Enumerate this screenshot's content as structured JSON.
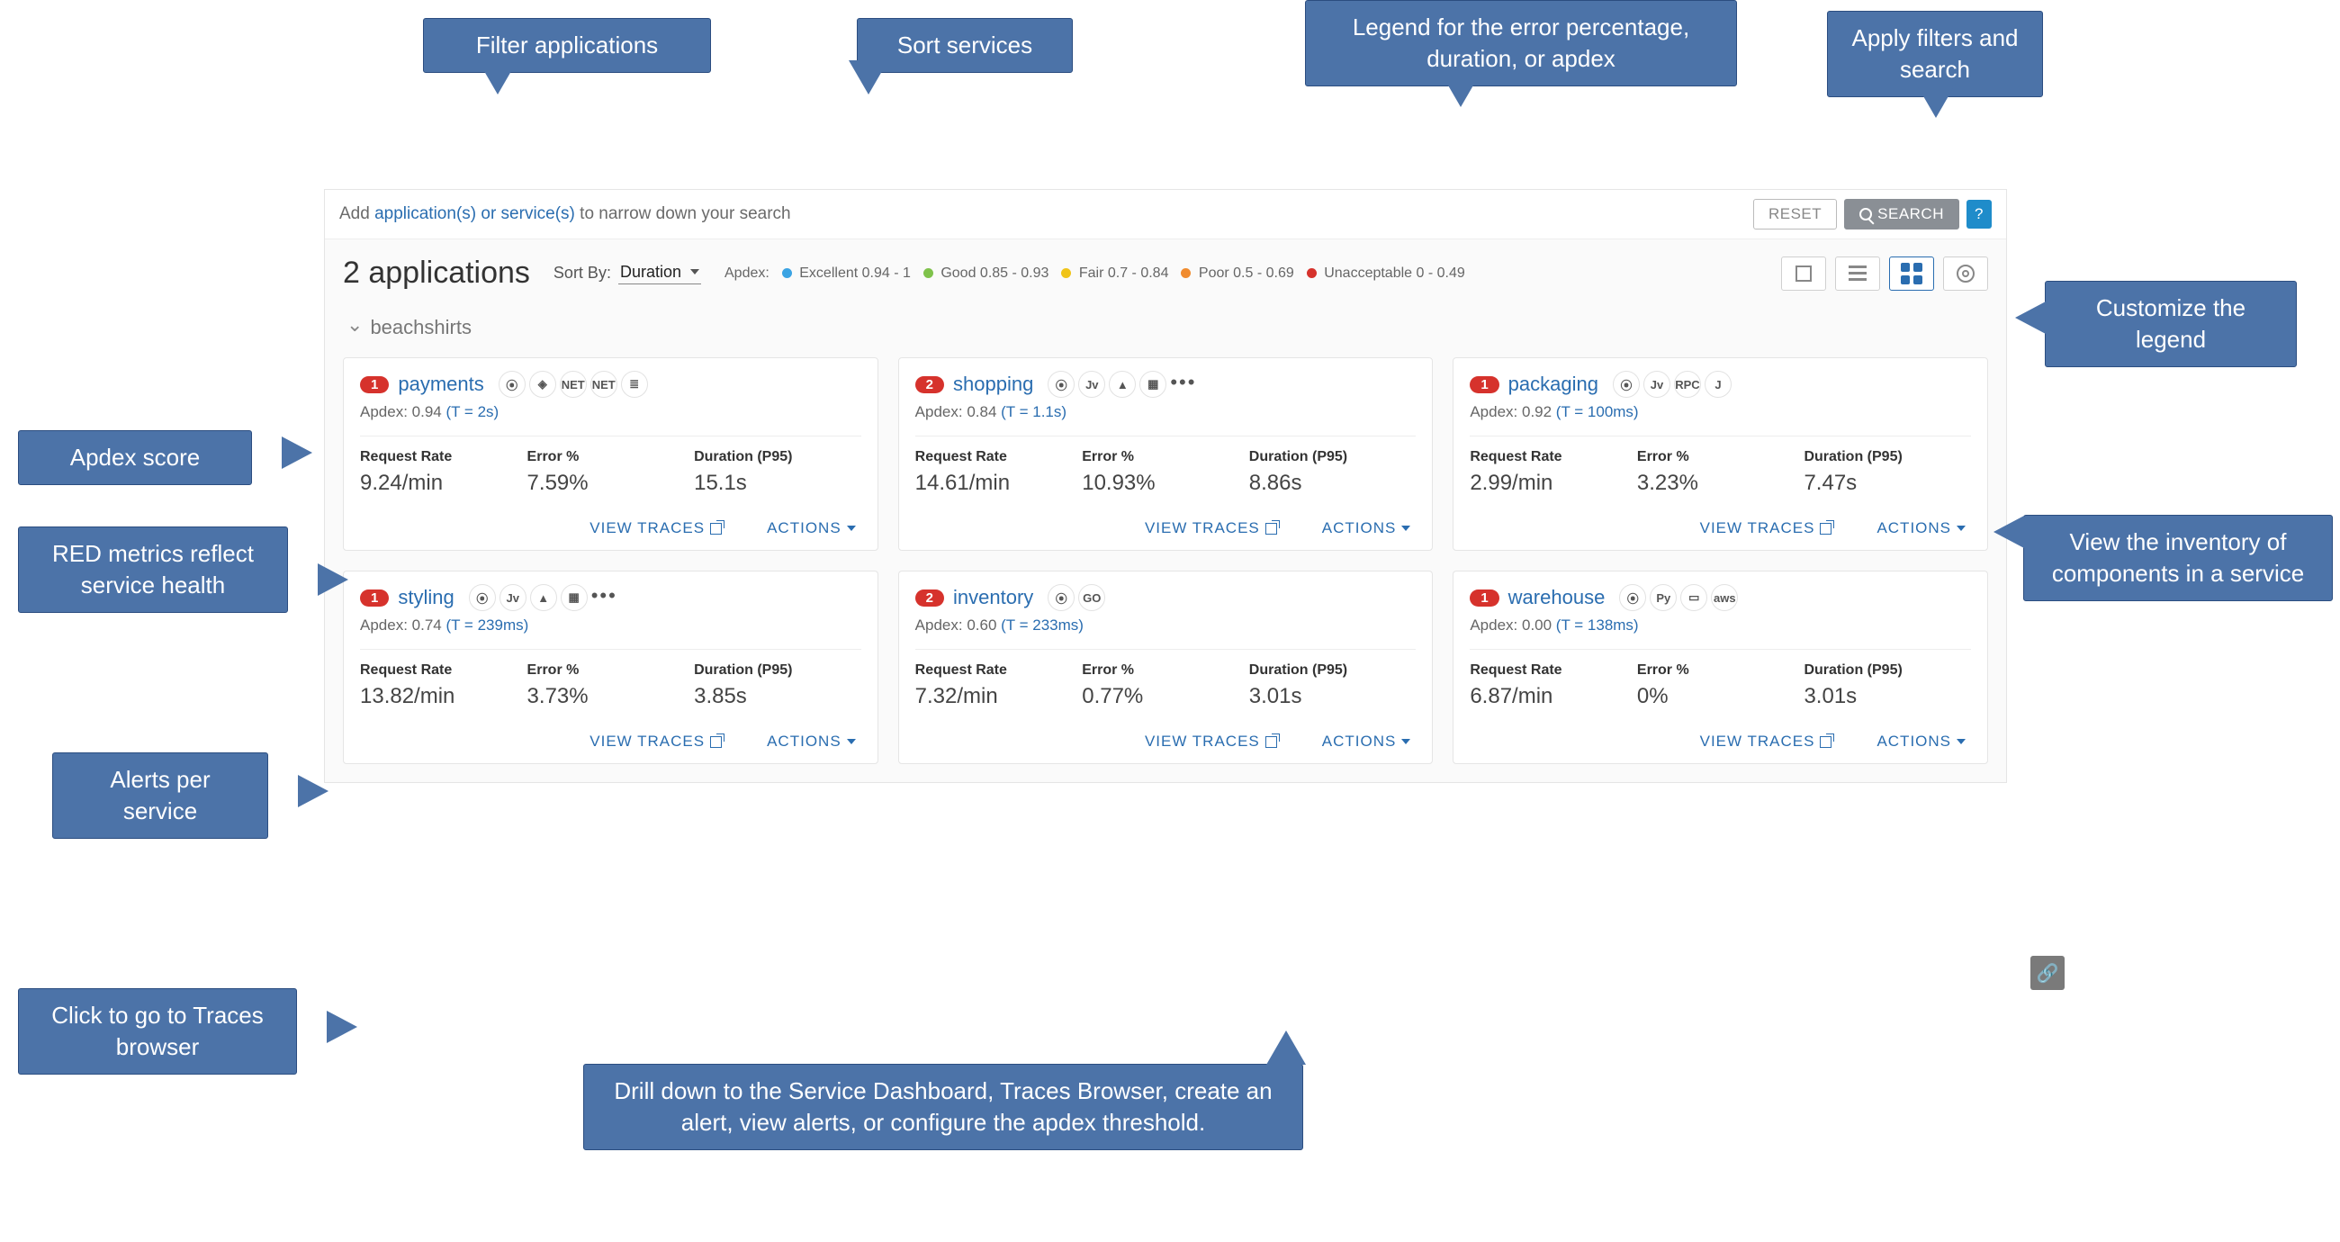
{
  "search": {
    "prefix": "Add ",
    "link_apps": "application(s) or service(s)",
    "suffix": " to narrow down your search",
    "reset": "RESET",
    "search": "SEARCH",
    "help": "?"
  },
  "header": {
    "count_label": "2 applications",
    "sort_label": "Sort By:",
    "sort_value": "Duration"
  },
  "legend": {
    "title": "Apdex:",
    "items": [
      {
        "color": "#3aa3e3",
        "label": "Excellent 0.94 - 1"
      },
      {
        "color": "#7fc24b",
        "label": "Good 0.85 - 0.93"
      },
      {
        "color": "#f0c419",
        "label": "Fair 0.7 - 0.84"
      },
      {
        "color": "#f08b2f",
        "label": "Poor 0.5 - 0.69"
      },
      {
        "color": "#d6322c",
        "label": "Unacceptable 0 - 0.49"
      }
    ]
  },
  "group": {
    "name": "beachshirts"
  },
  "metric_labels": {
    "rate": "Request Rate",
    "error": "Error %",
    "duration": "Duration (P95)"
  },
  "card_actions": {
    "view_traces": "VIEW TRACES",
    "actions": "ACTIONS"
  },
  "services": [
    {
      "alerts": "1",
      "name": "payments",
      "apdex_dot": "#3aa3e3",
      "apdex": "0.94",
      "t": "(T = 2s)",
      "rate": "9.24/min",
      "error": "7.59%",
      "dur": "15.1s",
      "icons": [
        "⦿",
        "◈",
        "NET",
        "NET",
        "≣"
      ]
    },
    {
      "alerts": "2",
      "name": "shopping",
      "apdex_dot": "#f0c419",
      "apdex": "0.84",
      "t": "(T = 1.1s)",
      "rate": "14.61/min",
      "error": "10.93%",
      "dur": "8.86s",
      "icons": [
        "⦿",
        "Jv",
        "▲",
        "▦",
        "…"
      ]
    },
    {
      "alerts": "1",
      "name": "packaging",
      "apdex_dot": "#7fc24b",
      "apdex": "0.92",
      "t": "(T = 100ms)",
      "rate": "2.99/min",
      "error": "3.23%",
      "dur": "7.47s",
      "icons": [
        "⦿",
        "Jv",
        "RPC",
        "J"
      ]
    },
    {
      "alerts": "1",
      "name": "styling",
      "apdex_dot": "#f0c419",
      "apdex": "0.74",
      "t": "(T = 239ms)",
      "rate": "13.82/min",
      "error": "3.73%",
      "dur": "3.85s",
      "icons": [
        "⦿",
        "Jv",
        "▲",
        "▦",
        "…"
      ]
    },
    {
      "alerts": "2",
      "name": "inventory",
      "apdex_dot": "#f08b2f",
      "apdex": "0.60",
      "t": "(T = 233ms)",
      "rate": "7.32/min",
      "error": "0.77%",
      "dur": "3.01s",
      "icons": [
        "⦿",
        "GO"
      ]
    },
    {
      "alerts": "1",
      "name": "warehouse",
      "apdex_dot": "#d6322c",
      "apdex": "0.00",
      "t": "(T = 138ms)",
      "rate": "6.87/min",
      "error": "0%",
      "dur": "3.01s",
      "icons": [
        "⦿",
        "Py",
        "▭",
        "aws"
      ]
    }
  ],
  "callouts": {
    "filter_apps": "Filter applications",
    "sort_services": "Sort services",
    "legend_desc": "Legend for the error percentage, duration, or apdex",
    "filters_search": "Apply filters and search",
    "custom_legend": "Customize the legend",
    "apdex_score": "Apdex score",
    "red_metrics": "RED metrics reflect service health",
    "view_inventory": "View the inventory of components in a service",
    "alerts_per": "Alerts per service",
    "traces_browser": "Click to go to Traces browser",
    "drill_down": "Drill down to the Service Dashboard, Traces Browser, create an alert, view alerts, or configure the apdex threshold."
  }
}
